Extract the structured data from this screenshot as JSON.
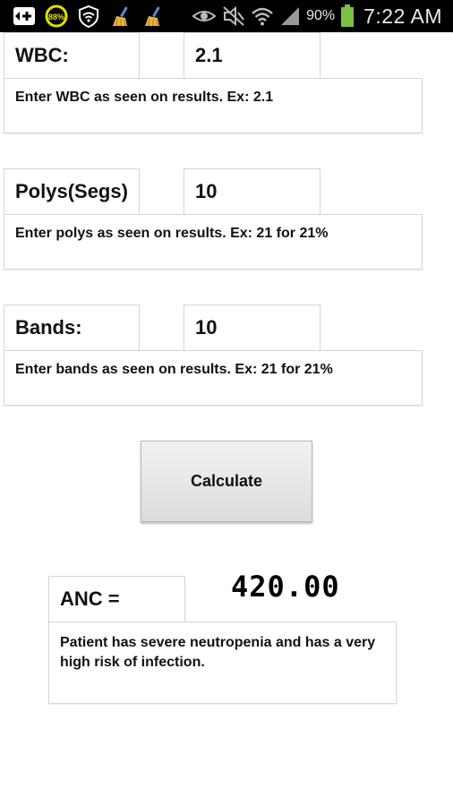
{
  "status_bar": {
    "battery_badge": "88%",
    "battery_percent": "90%",
    "time": "7:22 AM",
    "accent_battery": "#7bc043",
    "icons": [
      "add-box-icon",
      "battery-saver-icon",
      "shield-wifi-icon",
      "broom-icon",
      "broom-icon",
      "eye-icon",
      "mute-icon",
      "wifi-icon",
      "signal-icon",
      "battery-icon"
    ]
  },
  "wbc": {
    "label": "WBC:",
    "value": "2.1",
    "hint": "Enter WBC as seen on results. Ex: 2.1"
  },
  "polys": {
    "label": "Polys(Segs)",
    "value": "10",
    "hint": "Enter polys as seen on results. Ex: 21 for 21%"
  },
  "bands": {
    "label": "Bands:",
    "value": "10",
    "hint": "Enter bands as seen on results. Ex: 21 for 21%"
  },
  "calculate": {
    "label": "Calculate"
  },
  "result": {
    "label": "ANC =",
    "value": "420.00",
    "message": "Patient has severe neutropenia and has a very high risk of infection."
  }
}
